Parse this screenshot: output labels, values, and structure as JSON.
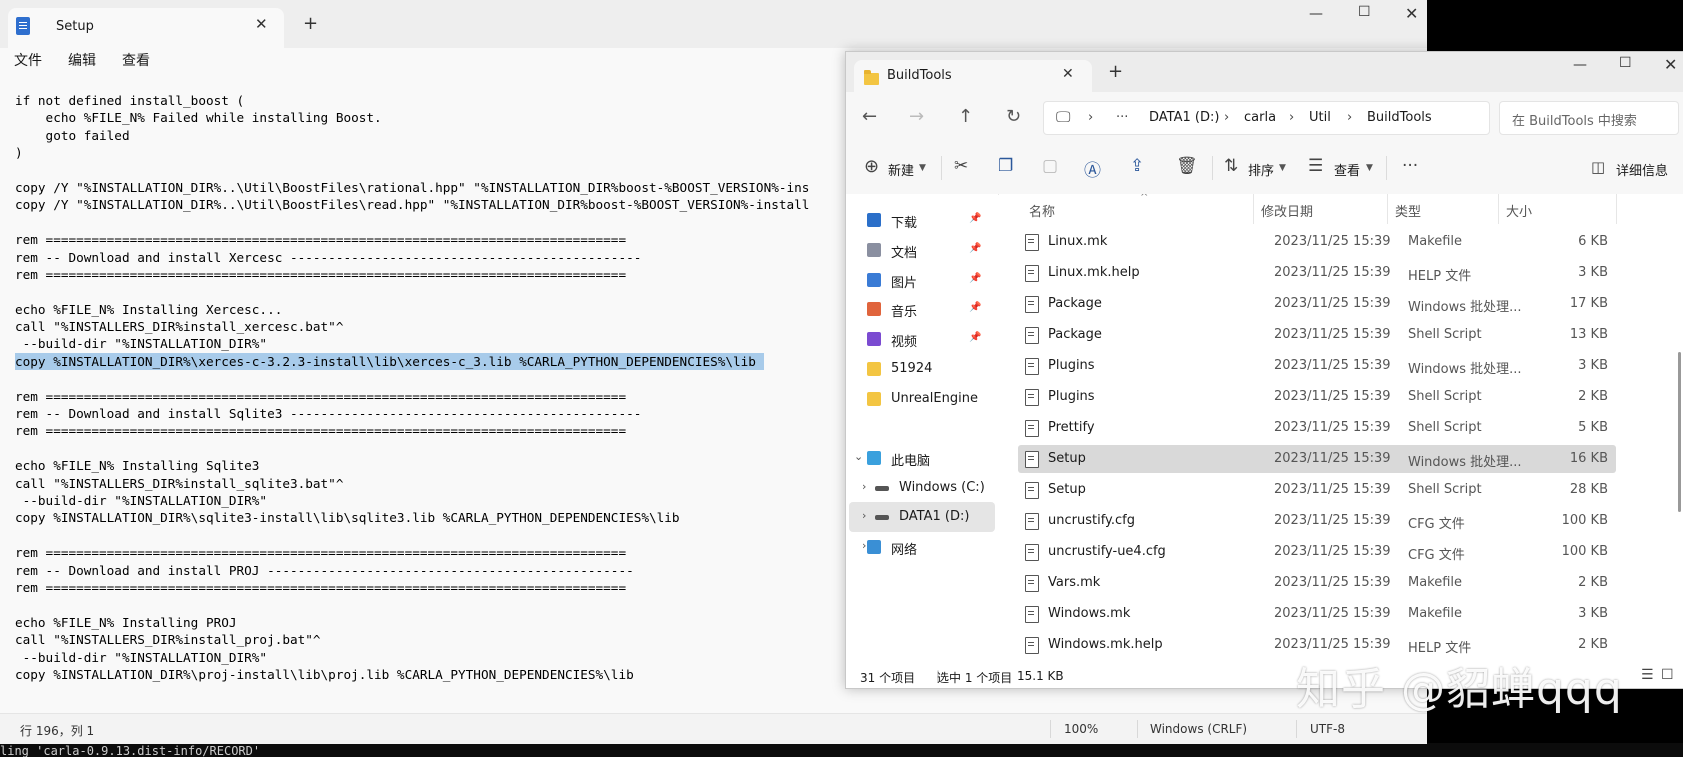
{
  "terminal": {
    "text": "ling 'carla-0.9.13.dist-info/RECORD'"
  },
  "notepad": {
    "tab_title": "Setup",
    "menu": [
      "文件",
      "编辑",
      "查看"
    ],
    "code_lines": [
      "if not defined install_boost (",
      "    echo %FILE_N% Failed while installing Boost.",
      "    goto failed",
      ")",
      "",
      "copy /Y \"%INSTALLATION_DIR%..\\Util\\BoostFiles\\rational.hpp\" \"%INSTALLATION_DIR%boost-%BOOST_VERSION%-ins",
      "copy /Y \"%INSTALLATION_DIR%..\\Util\\BoostFiles\\read.hpp\" \"%INSTALLATION_DIR%boost-%BOOST_VERSION%-install",
      "",
      "rem ============================================================================",
      "rem -- Download and install Xercesc ----------------------------------------------",
      "rem ============================================================================",
      "",
      "echo %FILE_N% Installing Xercesc...",
      "call \"%INSTALLERS_DIR%install_xercesc.bat\"^",
      " --build-dir \"%INSTALLATION_DIR%\"",
      "copy %INSTALLATION_DIR%\\xerces-c-3.2.3-install\\lib\\xerces-c_3.lib %CARLA_PYTHON_DEPENDENCIES%\\lib",
      "",
      "rem ============================================================================",
      "rem -- Download and install Sqlite3 ----------------------------------------------",
      "rem ============================================================================",
      "",
      "echo %FILE_N% Installing Sqlite3",
      "call \"%INSTALLERS_DIR%install_sqlite3.bat\"^",
      " --build-dir \"%INSTALLATION_DIR%\"",
      "copy %INSTALLATION_DIR%\\sqlite3-install\\lib\\sqlite3.lib %CARLA_PYTHON_DEPENDENCIES%\\lib",
      "",
      "rem ============================================================================",
      "rem -- Download and install PROJ ------------------------------------------------",
      "rem ============================================================================",
      "",
      "echo %FILE_N% Installing PROJ",
      "call \"%INSTALLERS_DIR%install_proj.bat\"^",
      " --build-dir \"%INSTALLATION_DIR%\"",
      "copy %INSTALLATION_DIR%\\proj-install\\lib\\proj.lib %CARLA_PYTHON_DEPENDENCIES%\\lib"
    ],
    "highlighted_line": 15,
    "status": {
      "position": "行 196，列 1",
      "zoom": "100%",
      "line_ending": "Windows (CRLF)",
      "encoding": "UTF-8"
    }
  },
  "explorer": {
    "tab_title": "BuildTools",
    "breadcrumb": [
      "DATA1 (D:)",
      "carla",
      "Util",
      "BuildTools"
    ],
    "search_placeholder": "在 BuildTools 中搜索",
    "toolbar": {
      "new": "新建",
      "sort": "排序",
      "view": "查看",
      "details": "详细信息"
    },
    "nav": [
      {
        "label": "下载",
        "icon": "download-icon",
        "pinned": true
      },
      {
        "label": "文档",
        "icon": "document-icon",
        "pinned": true
      },
      {
        "label": "图片",
        "icon": "picture-icon",
        "pinned": true
      },
      {
        "label": "音乐",
        "icon": "music-icon",
        "pinned": true
      },
      {
        "label": "视频",
        "icon": "video-icon",
        "pinned": true
      },
      {
        "label": "51924",
        "icon": "folder-icon",
        "pinned": false
      },
      {
        "label": "UnrealEngine",
        "icon": "folder-icon",
        "pinned": false
      },
      {
        "label": "此电脑",
        "icon": "computer-icon",
        "pinned": false
      },
      {
        "label": "Windows (C:)",
        "icon": "drive-icon",
        "pinned": false
      },
      {
        "label": "DATA1 (D:)",
        "icon": "drive-icon",
        "pinned": false
      },
      {
        "label": "网络",
        "icon": "network-icon",
        "pinned": false
      }
    ],
    "columns": [
      "名称",
      "修改日期",
      "类型",
      "大小"
    ],
    "files": [
      {
        "name": "Linux.mk",
        "date": "2023/11/25 15:39",
        "type": "Makefile",
        "size": "6 KB"
      },
      {
        "name": "Linux.mk.help",
        "date": "2023/11/25 15:39",
        "type": "HELP 文件",
        "size": "3 KB"
      },
      {
        "name": "Package",
        "date": "2023/11/25 15:39",
        "type": "Windows 批处理...",
        "size": "17 KB"
      },
      {
        "name": "Package",
        "date": "2023/11/25 15:39",
        "type": "Shell Script",
        "size": "13 KB"
      },
      {
        "name": "Plugins",
        "date": "2023/11/25 15:39",
        "type": "Windows 批处理...",
        "size": "3 KB"
      },
      {
        "name": "Plugins",
        "date": "2023/11/25 15:39",
        "type": "Shell Script",
        "size": "2 KB"
      },
      {
        "name": "Prettify",
        "date": "2023/11/25 15:39",
        "type": "Shell Script",
        "size": "5 KB"
      },
      {
        "name": "Setup",
        "date": "2023/11/25 15:39",
        "type": "Windows 批处理...",
        "size": "16 KB"
      },
      {
        "name": "Setup",
        "date": "2023/11/25 15:39",
        "type": "Shell Script",
        "size": "28 KB"
      },
      {
        "name": "uncrustify.cfg",
        "date": "2023/11/25 15:39",
        "type": "CFG 文件",
        "size": "100 KB"
      },
      {
        "name": "uncrustify-ue4.cfg",
        "date": "2023/11/25 15:39",
        "type": "CFG 文件",
        "size": "100 KB"
      },
      {
        "name": "Vars.mk",
        "date": "2023/11/25 15:39",
        "type": "Makefile",
        "size": "2 KB"
      },
      {
        "name": "Windows.mk",
        "date": "2023/11/25 15:39",
        "type": "Makefile",
        "size": "3 KB"
      },
      {
        "name": "Windows.mk.help",
        "date": "2023/11/25 15:39",
        "type": "HELP 文件",
        "size": "2 KB"
      }
    ],
    "selected_file": 7,
    "status": {
      "count": "31 个项目",
      "selected": "选中 1 个项目",
      "size": "15.1 KB"
    }
  },
  "watermark": {
    "text": "知乎 @貂蝉qqq"
  }
}
